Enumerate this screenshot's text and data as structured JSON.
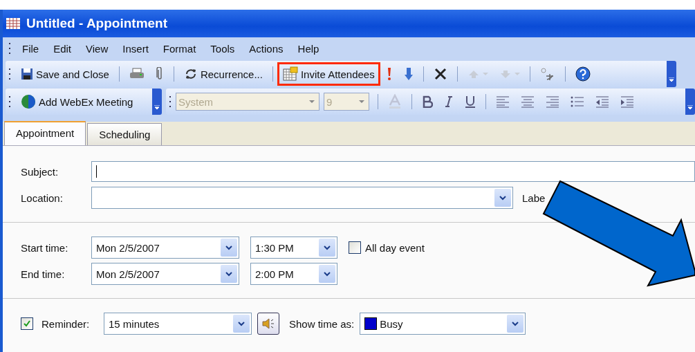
{
  "window": {
    "title": "Untitled - Appointment"
  },
  "menu": [
    "File",
    "Edit",
    "View",
    "Insert",
    "Format",
    "Tools",
    "Actions",
    "Help"
  ],
  "toolbar_standard": [
    {
      "kind": "button",
      "label": "Save and Close",
      "highlighted": false
    },
    {
      "kind": "separator"
    },
    {
      "kind": "button",
      "highlighted": false
    },
    {
      "kind": "button",
      "highlighted": false
    },
    {
      "kind": "separator"
    },
    {
      "kind": "button",
      "label": "Recurrence...",
      "highlighted": false
    },
    {
      "kind": "separator"
    },
    {
      "kind": "button",
      "label": "Invite Attendees",
      "highlighted": true
    },
    {
      "kind": "button",
      "highlighted": false
    },
    {
      "kind": "button",
      "highlighted": false
    },
    {
      "kind": "separator"
    },
    {
      "kind": "button",
      "highlighted": false
    },
    {
      "kind": "separator"
    },
    {
      "kind": "button",
      "disabled": true,
      "highlighted": false
    },
    {
      "kind": "button",
      "disabled": true,
      "highlighted": false
    },
    {
      "kind": "separator"
    },
    {
      "kind": "button",
      "highlighted": false
    },
    {
      "kind": "separator"
    },
    {
      "kind": "button",
      "highlighted": false
    }
  ],
  "toolbar_webex": {
    "label": "Add WebEx Meeting"
  },
  "toolbar_format": [
    {
      "kind": "combo",
      "value": "System",
      "disabled": true
    },
    {
      "kind": "combo",
      "value": "9",
      "disabled": true
    },
    {
      "kind": "separator"
    },
    {
      "kind": "button",
      "disabled": true
    },
    {
      "kind": "separator"
    },
    {
      "kind": "button",
      "disabled": false
    },
    {
      "kind": "button",
      "disabled": false
    },
    {
      "kind": "button",
      "disabled": false
    },
    {
      "kind": "separator"
    },
    {
      "kind": "button",
      "disabled": false
    },
    {
      "kind": "button",
      "disabled": false
    },
    {
      "kind": "button",
      "disabled": false
    },
    {
      "kind": "button",
      "disabled": false
    },
    {
      "kind": "button",
      "disabled": false
    },
    {
      "kind": "button",
      "disabled": false
    }
  ],
  "tabs": [
    {
      "label": "Appointment",
      "selected": true
    },
    {
      "label": "Scheduling",
      "selected": false
    }
  ],
  "subject": {
    "label": "Subject:"
  },
  "location": {
    "label": "Location:"
  },
  "label_field": {
    "label": "Labe"
  },
  "start": {
    "label": "Start time:",
    "date": "Mon 2/5/2007",
    "time": "1:30 PM"
  },
  "all_day": {
    "label": "All day event",
    "checked": false
  },
  "end": {
    "label": "End time:",
    "date": "Mon 2/5/2007",
    "time": "2:00 PM"
  },
  "reminder": {
    "label": "Reminder:",
    "checked": true,
    "value": "15 minutes"
  },
  "show_time_as": {
    "label": "Show time as:",
    "value": "Busy",
    "color": "#0000cc"
  }
}
